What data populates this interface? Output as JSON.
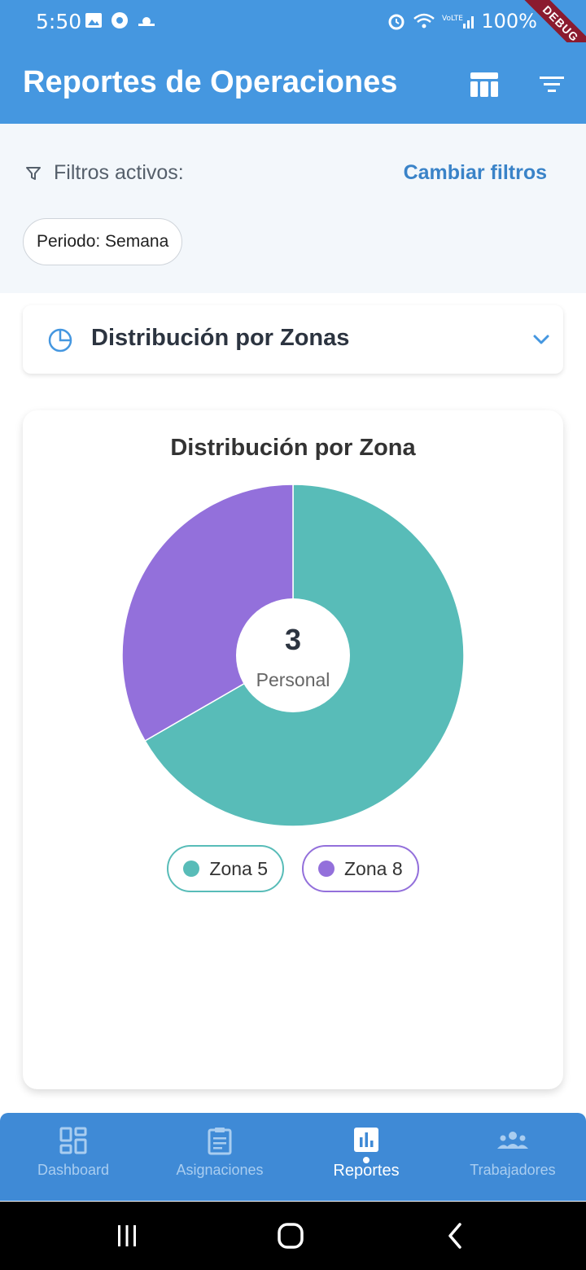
{
  "status_bar": {
    "time": "5:50",
    "battery": "100%",
    "debug_banner": "DEBUG"
  },
  "app_bar": {
    "title": "Reportes de Operaciones",
    "icons": [
      "table-view-icon",
      "filter-list-icon"
    ]
  },
  "filters": {
    "label": "Filtros activos:",
    "change_label": "Cambiar filtros",
    "chips": [
      "Periodo: Semana"
    ]
  },
  "section": {
    "title": "Distribución por Zonas",
    "icon": "pie-chart-icon"
  },
  "chart_data": {
    "type": "pie",
    "title": "Distribución por Zona",
    "center_value": "3",
    "center_label": "Personal",
    "categories": [
      "Zona 5",
      "Zona 8"
    ],
    "values": [
      2,
      1
    ],
    "colors": [
      "#58bcb8",
      "#9370db"
    ],
    "legend_placement": "bottom"
  },
  "bottom_nav": {
    "items": [
      {
        "label": "Dashboard",
        "icon": "dashboard-icon"
      },
      {
        "label": "Asignaciones",
        "icon": "clipboard-icon"
      },
      {
        "label": "Reportes",
        "icon": "bar-chart-icon"
      },
      {
        "label": "Trabajadores",
        "icon": "people-icon"
      }
    ],
    "active_index": 2
  },
  "colors": {
    "primary": "#4597e0",
    "nav": "#3f8ad6",
    "accent_text": "#3a83c8"
  }
}
